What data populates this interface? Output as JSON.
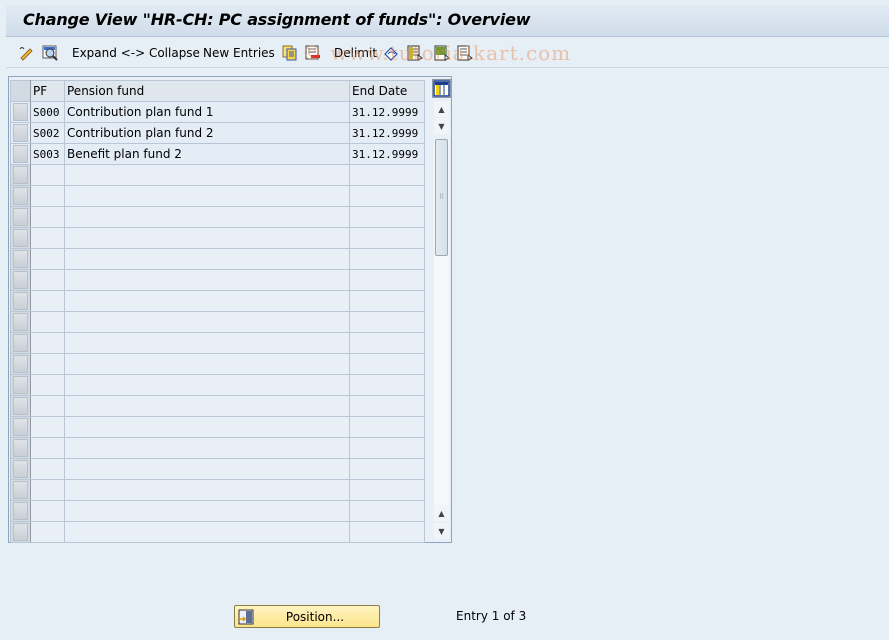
{
  "window": {
    "title": "Change View \"HR-CH: PC assignment of funds\": Overview"
  },
  "toolbar": {
    "items": [
      {
        "icon": "edit-pencil-icon"
      },
      {
        "icon": "display-details-icon"
      },
      {
        "label": "Expand <-> Collapse"
      },
      {
        "label": "New Entries"
      },
      {
        "icon": "copy-as-icon"
      },
      {
        "icon": "delete-icon"
      },
      {
        "label": "Delimit"
      },
      {
        "icon": "undo-change-icon"
      },
      {
        "icon": "select-all-icon"
      },
      {
        "icon": "select-block-icon"
      },
      {
        "icon": "deselect-all-icon"
      }
    ],
    "watermark": "© www.tutorialkart.com"
  },
  "table": {
    "columns": [
      "PF",
      "Pension fund",
      "End Date"
    ],
    "rows": [
      {
        "pf": "S000",
        "name": "Contribution plan fund 1",
        "end_date": "31.12.9999"
      },
      {
        "pf": "S002",
        "name": "Contribution plan fund 2",
        "end_date": "31.12.9999"
      },
      {
        "pf": "S003",
        "name": "Benefit plan fund 2",
        "end_date": "31.12.9999"
      }
    ],
    "total_visible_rows": 21
  },
  "footer": {
    "position_button": "Position...",
    "entry_text": "Entry 1 of 3"
  }
}
